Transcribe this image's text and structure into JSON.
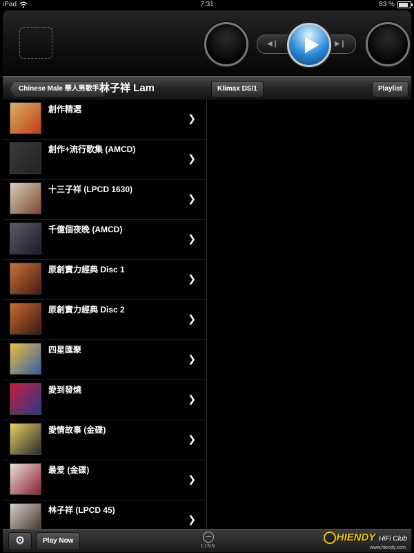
{
  "status_bar": {
    "device": "iPad",
    "time": "7:31",
    "battery": "83 %",
    "battery_level": 0.83
  },
  "transport": {
    "prev_icon": "skip-previous-icon",
    "play_icon": "play-icon",
    "next_icon": "skip-next-icon"
  },
  "nav": {
    "back_label": "Chinese Male 華人男歌手",
    "title": "林子祥 Lam",
    "device_label": "Klimax DS/1",
    "playlist_label": "Playlist"
  },
  "albums": [
    {
      "title": "創作精選",
      "cover_colors": [
        "#d8b45a",
        "#c03a1c"
      ]
    },
    {
      "title": "創作+流行歌集 (AMCD)",
      "cover_colors": [
        "#3a3a3a",
        "#222222"
      ]
    },
    {
      "title": "十三子祥 (LPCD 1630)",
      "cover_colors": [
        "#d8cfb8",
        "#7a4a30"
      ]
    },
    {
      "title": "千億個夜晚 (AMCD)",
      "cover_colors": [
        "#5a5a6a",
        "#1c1c28"
      ]
    },
    {
      "title": "原創實力經典 Disc 1",
      "cover_colors": [
        "#c8743a",
        "#4a1a10"
      ]
    },
    {
      "title": "原創實力經典 Disc 2",
      "cover_colors": [
        "#c86a30",
        "#3a1a10"
      ]
    },
    {
      "title": "四星匯聚",
      "cover_colors": [
        "#e8c240",
        "#3a5aa8"
      ]
    },
    {
      "title": "愛到發燒",
      "cover_colors": [
        "#c81c3a",
        "#2a3a8a"
      ]
    },
    {
      "title": "愛情故事 (金碟)",
      "cover_colors": [
        "#e8d060",
        "#2a2a2a"
      ]
    },
    {
      "title": "最爱 (金碟)",
      "cover_colors": [
        "#e8e0d8",
        "#8a2030"
      ]
    },
    {
      "title": "林子祥 (LPCD 45)",
      "cover_colors": [
        "#d8d0c8",
        "#3a2a20"
      ]
    }
  ],
  "toolbar": {
    "settings_icon": "gear-icon",
    "play_now_label": "Play Now",
    "logo_text": "LINN"
  },
  "watermark": {
    "brand": "HIENDY",
    "sub": "HiFi Club",
    "url": "www.hiendy.com"
  }
}
